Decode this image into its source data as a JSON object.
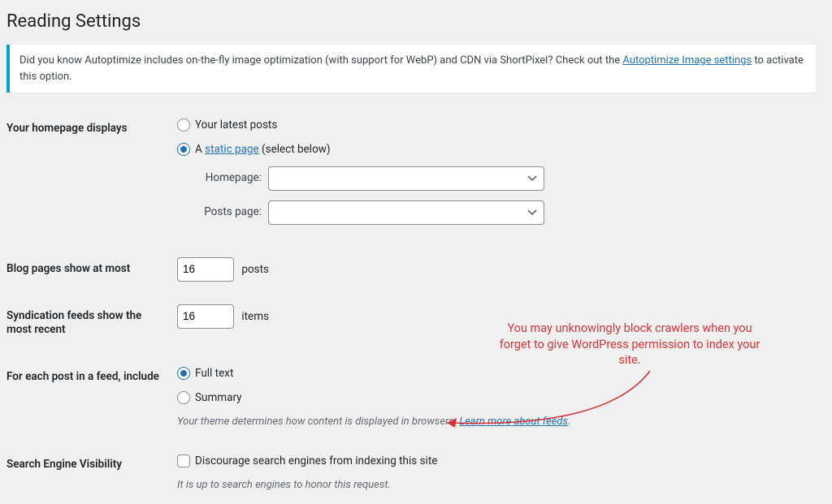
{
  "page_title": "Reading Settings",
  "notice": {
    "prefix": "Did you know Autoptimize includes on-the-fly image optimization (with support for WebP) and CDN via ShortPixel? Check out the ",
    "link_text": "Autoptimize Image settings",
    "suffix": " to activate this option."
  },
  "homepage": {
    "label": "Your homepage displays",
    "option_latest": "Your latest posts",
    "option_static_prefix": "A ",
    "option_static_link": "static page",
    "option_static_suffix": " (select below)",
    "selected": "static",
    "homepage_label": "Homepage:",
    "postspage_label": "Posts page:",
    "homepage_value": "",
    "postspage_value": ""
  },
  "blog_pages": {
    "label": "Blog pages show at most",
    "value": "16",
    "unit": "posts"
  },
  "syndication": {
    "label": "Syndication feeds show the most recent",
    "value": "16",
    "unit": "items"
  },
  "feed_content": {
    "label": "For each post in a feed, include",
    "option_full": "Full text",
    "option_summary": "Summary",
    "selected": "full",
    "desc_prefix": "Your theme determines how content is displayed in browsers. ",
    "desc_link": "Learn more about feeds",
    "desc_suffix": "."
  },
  "visibility": {
    "label": "Search Engine Visibility",
    "checkbox_label": "Discourage search engines from indexing this site",
    "checked": false,
    "desc": "It is up to search engines to honor this request."
  },
  "annotation": "You may unknowingly block crawlers when you forget to give WordPress permission to index your site."
}
